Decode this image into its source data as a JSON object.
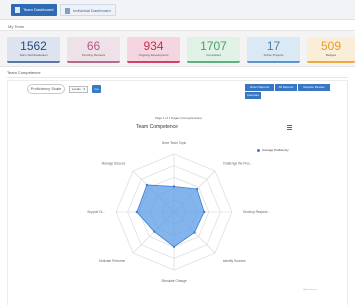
{
  "tabs": [
    {
      "label": "Team Dashboard"
    },
    {
      "label": "Individual Dashboard"
    }
  ],
  "breadcrumb": "My Team",
  "stats": [
    {
      "value": "1562",
      "label": "Team Self-Evaluation"
    },
    {
      "value": "66",
      "label": "Pending Reviews"
    },
    {
      "value": "934",
      "label": "Ongoing Development"
    },
    {
      "value": "1707",
      "label": "Completed"
    },
    {
      "value": "17",
      "label": "Active Projects"
    },
    {
      "value": "509",
      "label": "Badges"
    }
  ],
  "section": {
    "title": "Team Competence"
  },
  "filters": {
    "proficiency_label": "Proficiency Scale",
    "scale_value": "Levels",
    "go_label": "Go"
  },
  "buttons": [
    "Direct Reports",
    "All Reports",
    "Require Review",
    "Compare"
  ],
  "pageinfo": "Page 1 of 1 Pages (Competencies)",
  "chart_data": {
    "type": "radar",
    "title": "Team Competence",
    "axes": [
      "Drive Team Topic",
      "Challenge the Proc...",
      "Develop Respect...",
      "Identify Sources",
      "Stimulate Change",
      "Motivate Performe",
      "Support Di...",
      "Manage Discuss"
    ],
    "series": [
      {
        "name": "Average Proficiency",
        "values": [
          2.2,
          2.8,
          2.6,
          2.5,
          3.0,
          2.4,
          3.2,
          3.3
        ]
      }
    ],
    "max": 5,
    "rings": 5,
    "colors": {
      "fill": "#5b9be6",
      "stroke": "#3c7dd3",
      "grid": "#d6d6d6"
    },
    "legend": "top-right"
  },
  "footnote": "Highcharts.com",
  "icons": {
    "tab_icon": "dashboard-icon",
    "menu": "hamburger-menu-icon"
  }
}
